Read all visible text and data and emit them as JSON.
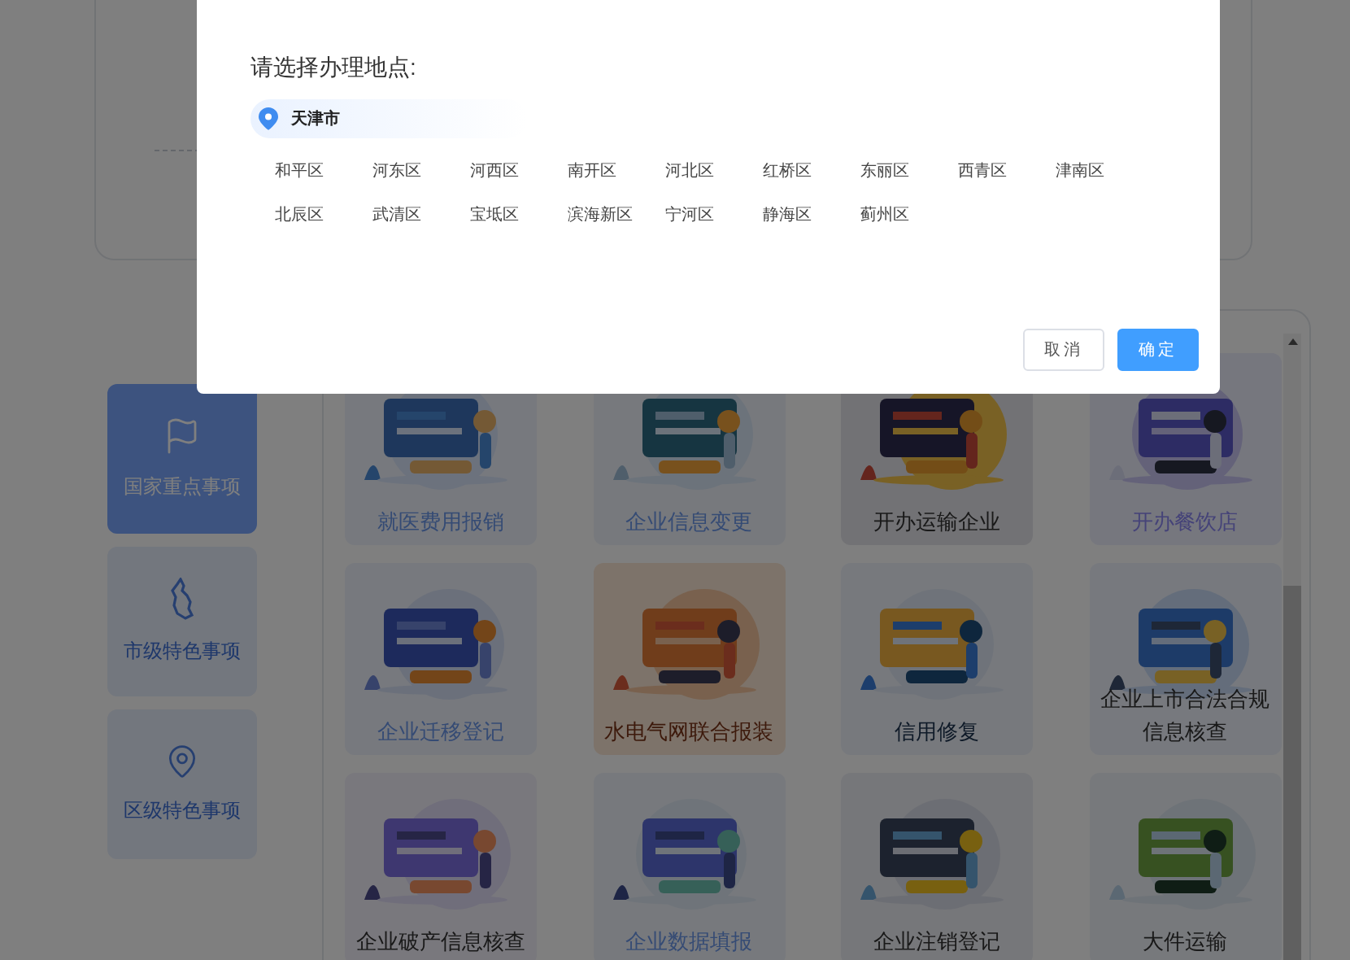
{
  "dialog": {
    "title": "请选择办理地点:",
    "city": "天津市",
    "districts": [
      "和平区",
      "河东区",
      "河西区",
      "南开区",
      "河北区",
      "红桥区",
      "东丽区",
      "西青区",
      "津南区",
      "北辰区",
      "武清区",
      "宝坻区",
      "滨海新区",
      "宁河区",
      "静海区",
      "蓟州区"
    ],
    "buttons": [
      {
        "label": "取消",
        "kind": "secondary"
      },
      {
        "label": "确定",
        "kind": "primary"
      }
    ]
  },
  "sidebar": {
    "items": [
      {
        "label": "国家重点事项",
        "selected": true
      },
      {
        "label": "市级特色事项",
        "selected": false
      },
      {
        "label": "区级特色事项",
        "selected": false
      }
    ]
  },
  "services": [
    {
      "label": "就医费用报销"
    },
    {
      "label": "企业信息变更"
    },
    {
      "label": "开办运输企业"
    },
    {
      "label": "开办餐饮店"
    },
    {
      "label": "企业迁移登记"
    },
    {
      "label": "水电气网联合报装"
    },
    {
      "label": "信用修复"
    },
    {
      "label": "企业上市合法合规信息核查"
    },
    {
      "label": "企业破产信息核查"
    },
    {
      "label": "企业数据填报"
    },
    {
      "label": "企业注销登记"
    },
    {
      "label": "大件运输"
    }
  ]
}
